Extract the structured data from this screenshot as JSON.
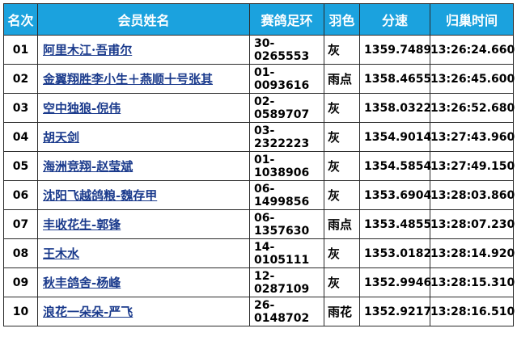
{
  "table": {
    "headers": [
      "名次",
      "会员姓名",
      "赛鸽足环",
      "羽色",
      "分速",
      "归巢时间"
    ],
    "rows": [
      {
        "rank": "01",
        "name": "阿里木江·吾甫尔",
        "ring": "30-0265553",
        "color": "灰",
        "speed": "1359.7489",
        "time": "13:26:24.660"
      },
      {
        "rank": "02",
        "name": "金翼翔胜李小生＋燕顺十号张其",
        "ring": "01-0093616",
        "color": "雨点",
        "speed": "1358.4655",
        "time": "13:26:45.600"
      },
      {
        "rank": "03",
        "name": "空中独狼-倪伟",
        "ring": "02-0589707",
        "color": "灰",
        "speed": "1358.0322",
        "time": "13:26:52.680"
      },
      {
        "rank": "04",
        "name": "胡天剑",
        "ring": "03-2322223",
        "color": "灰",
        "speed": "1354.9014",
        "time": "13:27:43.960"
      },
      {
        "rank": "05",
        "name": "海洲竞翔-赵莹斌",
        "ring": "01-1038906",
        "color": "灰",
        "speed": "1354.5854",
        "time": "13:27:49.150"
      },
      {
        "rank": "06",
        "name": "沈阳飞越鸽粮-魏存甲",
        "ring": "06-1499856",
        "color": "灰",
        "speed": "1353.6904",
        "time": "13:28:03.860"
      },
      {
        "rank": "07",
        "name": "丰收花生-郭锋",
        "ring": "06-1357630",
        "color": "雨点",
        "speed": "1353.4855",
        "time": "13:28:07.230"
      },
      {
        "rank": "08",
        "name": "王木水",
        "ring": "14-0105111",
        "color": "灰",
        "speed": "1353.0182",
        "time": "13:28:14.920"
      },
      {
        "rank": "09",
        "name": "秋丰鸽舍-杨峰",
        "ring": "12-0287109",
        "color": "灰",
        "speed": "1352.9946",
        "time": "13:28:15.310"
      },
      {
        "rank": "10",
        "name": "浪花一朵朵-严飞",
        "ring": "26-0148702",
        "color": "雨花",
        "speed": "1352.9217",
        "time": "13:28:16.510"
      }
    ]
  },
  "colors": {
    "header_bg": "#1ba2de",
    "header_text": "#ffffff",
    "link_text": "#1a3a8c",
    "border": "#2b2b2b"
  }
}
